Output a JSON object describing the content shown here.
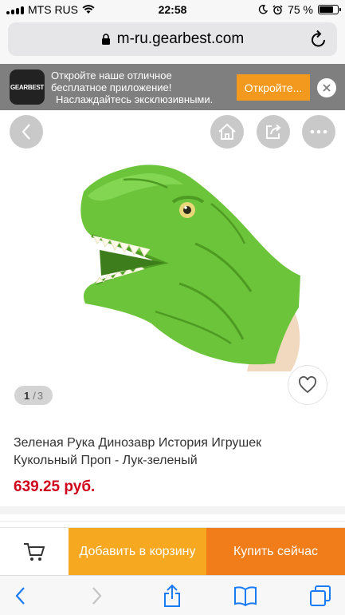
{
  "status_bar": {
    "carrier": "MTS RUS",
    "time": "22:58",
    "battery": "75 %",
    "battery_level": 0.75
  },
  "browser": {
    "url": "m-ru.gearbest.com"
  },
  "app_banner": {
    "logo_text": "GEARBEST",
    "line1": "Откройте наше отличное",
    "line2": "бесплатное приложение!",
    "line3": "Наслаждайтесь эксклюзивными.",
    "open_label": "Откройте..."
  },
  "product": {
    "image_current": "1",
    "image_separator": "/",
    "image_total": "3",
    "title_line1": "Зеленая Рука Динозавр История Игрушек",
    "title_line2": "Кукольный Проп - Лук-зеленый",
    "price": "639.25 руб."
  },
  "actions": {
    "add_to_cart": "Добавить в корзину",
    "buy_now": "Купить сейчас"
  },
  "colors": {
    "accent_orange": "#f07d19",
    "add_to_cart_orange": "#f6a821",
    "price_red": "#d0021b",
    "dino_green": "#6cc43a"
  },
  "icons": [
    "wifi-icon",
    "moon-icon",
    "alarm-icon",
    "lock-icon",
    "reload-icon",
    "close-icon",
    "chevron-left-icon",
    "home-icon",
    "share-icon",
    "more-icon",
    "heart-icon",
    "cart-icon",
    "forward-icon",
    "bookmarks-icon",
    "tabs-icon"
  ]
}
